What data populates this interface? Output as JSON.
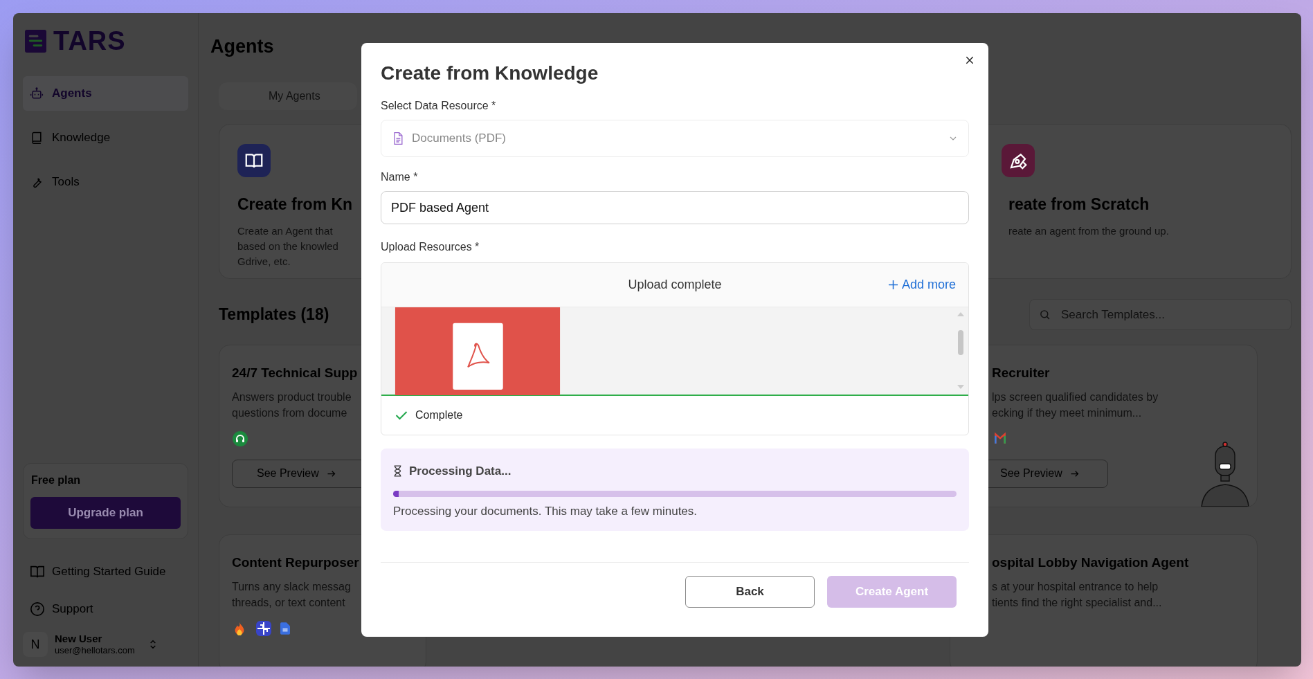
{
  "sidebar": {
    "logo": "TARS",
    "nav": [
      {
        "label": "Agents",
        "selected": true
      },
      {
        "label": "Knowledge",
        "selected": false
      },
      {
        "label": "Tools",
        "selected": false
      }
    ],
    "plan": {
      "title": "Free plan",
      "button": "Upgrade plan"
    },
    "links": [
      "Getting Started Guide",
      "Support"
    ],
    "user": {
      "initial": "N",
      "name": "New User",
      "email": "user@hellotars.com"
    }
  },
  "main": {
    "title": "Agents",
    "tabs": [
      {
        "label": "My Agents",
        "selected": false
      }
    ],
    "create_cards": [
      {
        "title": "Create from Kn",
        "lines": [
          "Create an Agent that",
          "based on the knowled",
          "Gdrive, etc."
        ],
        "color": "#1e2356"
      },
      {
        "title": "reate from Scratch",
        "lines": [
          "reate an agent from the ground up."
        ],
        "color": "#5a1838"
      }
    ],
    "templates_title": "Templates (18)",
    "search": {
      "placeholder": "Search Templates..."
    },
    "template_cards": [
      {
        "title": "24/7 Technical Supp",
        "lines": [
          "Answers product trouble",
          "questions from docume"
        ],
        "button": "See Preview"
      },
      {
        "title": "Recruiter",
        "lines": [
          "lps screen qualified candidates by",
          "ecking if they meet minimum..."
        ],
        "button": "See Preview"
      },
      {
        "title": "Content Repurposer",
        "lines": [
          "Turns any slack messag",
          "threads, or text content"
        ]
      },
      {
        "title": "ospital Lobby Navigation Agent",
        "lines": [
          "s at your hospital entrance to help",
          "tients find the right specialist and..."
        ]
      }
    ]
  },
  "modal": {
    "title": "Create from Knowledge",
    "resource": {
      "label": "Select Data Resource *",
      "value": "Documents (PDF)",
      "disabled": true
    },
    "name": {
      "label": "Name *",
      "value": "PDF based Agent"
    },
    "upload": {
      "label": "Upload Resources *",
      "header": "Upload complete",
      "add_more": "Add more",
      "status": "Complete"
    },
    "processing": {
      "title": "Processing Data...",
      "level": 0.01,
      "message": "Processing your documents. This may take a few minutes."
    },
    "buttons": [
      {
        "label": "Back",
        "kind": "secondary",
        "disabled": false
      },
      {
        "label": "Create Agent",
        "kind": "primary",
        "disabled": true
      }
    ]
  }
}
